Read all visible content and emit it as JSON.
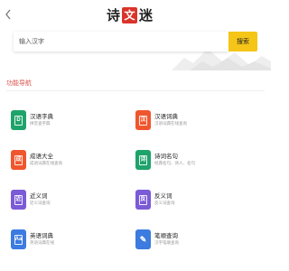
{
  "header": {
    "back_icon": "chevron-left-icon",
    "logo_chars": [
      "诗",
      "文",
      "迷"
    ],
    "accent_color": "#d9342b"
  },
  "search": {
    "placeholder": "输入汉字",
    "button_label": "搜索",
    "button_color": "#f5c518"
  },
  "section": {
    "title": "功能导航"
  },
  "items": [
    {
      "title": "汉语字典",
      "desc": "拼音查字典",
      "icon": "book-icon",
      "glyph": "D",
      "color": "#1ea36b"
    },
    {
      "title": "汉语词典",
      "desc": "汉语词典在线查询",
      "icon": "book-icon",
      "glyph": "汉",
      "color": "#f0562e"
    },
    {
      "title": "成语大全",
      "desc": "成语词典在线查询",
      "icon": "book-icon",
      "glyph": "成",
      "color": "#f0562e"
    },
    {
      "title": "诗词名句",
      "desc": "经典名句、诗人、名句",
      "icon": "book-icon",
      "glyph": "诗",
      "color": "#1ea36b"
    },
    {
      "title": "近义词",
      "desc": "近义词查询",
      "icon": "book-icon",
      "glyph": "近",
      "color": "#7b5bd6"
    },
    {
      "title": "反义词",
      "desc": "反义词查询",
      "icon": "book-icon",
      "glyph": "反",
      "color": "#7b5bd6"
    },
    {
      "title": "英语词典",
      "desc": "英语词典在线",
      "icon": "book-icon",
      "glyph": "Aa",
      "color": "#3c7be0"
    },
    {
      "title": "笔顺查询",
      "desc": "汉字笔顺查询",
      "icon": "pen-icon",
      "glyph": "✎",
      "color": "#3c7be0"
    }
  ]
}
